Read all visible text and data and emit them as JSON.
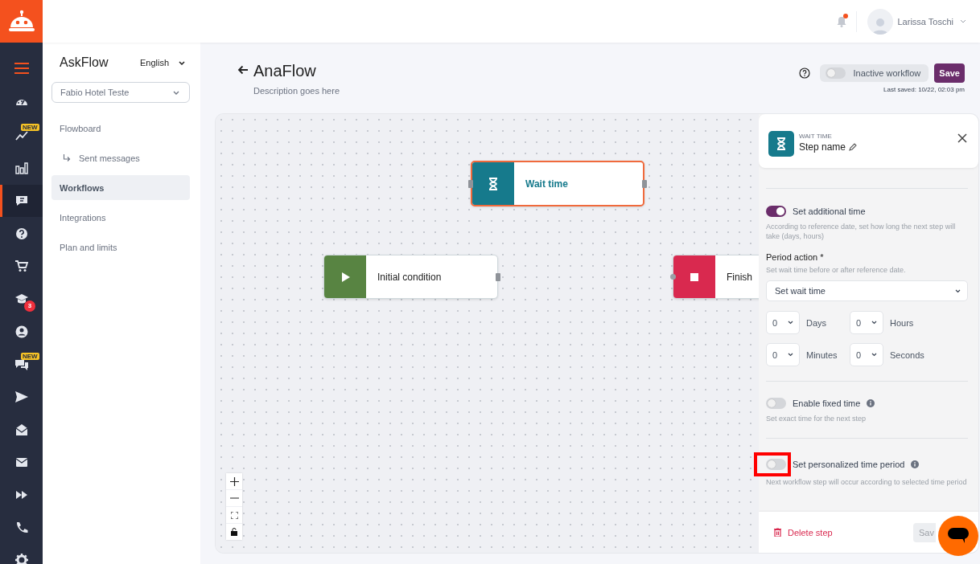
{
  "rail_items": [
    {
      "selected": false
    },
    {
      "selected": false,
      "badge": {
        "kind": "new",
        "text": "NEW"
      }
    },
    {
      "selected": false
    },
    {
      "selected": true
    },
    {
      "selected": false
    },
    {
      "selected": false
    },
    {
      "selected": false,
      "badge": {
        "kind": "count",
        "text": "3"
      }
    },
    {
      "selected": false
    },
    {
      "selected": false,
      "badge": {
        "kind": "new",
        "text": "NEW"
      }
    },
    {
      "selected": false
    },
    {
      "selected": false
    },
    {
      "selected": false
    },
    {
      "selected": false
    },
    {
      "selected": false
    },
    {
      "selected": false
    }
  ],
  "topbar": {
    "notifications": {
      "unread": true
    },
    "user": {
      "name": "Larissa Toschi"
    }
  },
  "subnav": {
    "title": "AskFlow",
    "language": "English",
    "account": "Fabio Hotel Teste",
    "items": [
      {
        "kind": "link",
        "label": "Flowboard",
        "selected": false
      },
      {
        "kind": "subitem",
        "label": "Sent messages",
        "selected": false
      },
      {
        "kind": "link",
        "label": "Workflows",
        "selected": true
      },
      {
        "kind": "link",
        "label": "Integrations",
        "selected": false
      },
      {
        "kind": "link",
        "label": "Plan and limits",
        "selected": false
      }
    ]
  },
  "header": {
    "title": "AnaFlow",
    "description": "Description goes here",
    "workflow_toggle": {
      "label": "Inactive workflow",
      "on": false
    },
    "save": "Save",
    "last_saved": "Last saved: 10/22, 02:03 pm"
  },
  "canvas": {
    "nodes": [
      {
        "kind": "wait",
        "label": "Wait time",
        "selected": true
      },
      {
        "kind": "start",
        "label": "Initial condition",
        "selected": false
      },
      {
        "kind": "finish",
        "label": "Finish",
        "selected": false
      }
    ]
  },
  "panel": {
    "type_label": "WAIT TIME",
    "step_name": "Step name",
    "additional_time": {
      "label": "Set additional time",
      "on": true,
      "description": "According to reference date, set how long the next step will take (days, hours)"
    },
    "period_action": {
      "label": "Period action *",
      "hint": "Set wait time before or after reference date.",
      "value": "Set wait time"
    },
    "durations": [
      {
        "value": "0",
        "unit": "Days"
      },
      {
        "value": "0",
        "unit": "Hours"
      },
      {
        "value": "0",
        "unit": "Minutes"
      },
      {
        "value": "0",
        "unit": "Seconds"
      }
    ],
    "fixed_time": {
      "label": "Enable fixed time",
      "on": false,
      "description": "Set exact time for the next step"
    },
    "personalized_period": {
      "label": "Set personalized time period",
      "on": false,
      "description": "Next workflow step will occur according to selected time period"
    },
    "delete": "Delete step",
    "save": {
      "label": "Sav",
      "disabled": true
    }
  }
}
